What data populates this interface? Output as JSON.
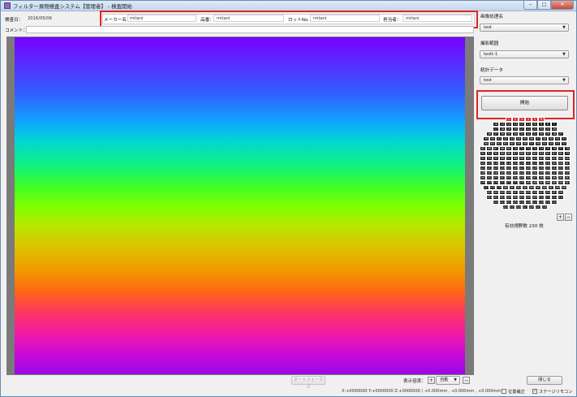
{
  "window": {
    "title": "フィルター異物検査システム【管理者】 - 検査開始",
    "min": "‒",
    "max": "□",
    "close": "✕"
  },
  "header": {
    "date_label": "検査日：",
    "date_value": "2016/05/06",
    "maker_label": "メーカー名：",
    "maker_value": "mitani",
    "product_label": "品番：",
    "product_value": "mitani",
    "lot_label": "ロットNo.：",
    "lot_value": "mitani",
    "person_label": "担当者：",
    "person_value": "mitani",
    "comment_label": "コメント："
  },
  "right": {
    "image_proc_label": "画像処理名",
    "image_proc_value": "test",
    "capture_range_label": "撮影範囲",
    "capture_range_value": "testt-1",
    "stats_label": "統計データ",
    "stats_value": "test",
    "start_button": "開始",
    "plus": "+",
    "minus": "−",
    "valid_fields": "有効視野数 230 枚"
  },
  "grid": {
    "rows": [
      {
        "cells": [
          "1",
          "2",
          "3",
          "4",
          "5",
          "6"
        ],
        "red": true
      },
      {
        "cells": [
          "16",
          "15",
          "14",
          "13",
          "12",
          "11",
          "10",
          "9",
          "8",
          "7"
        ]
      },
      {
        "cells": [
          "17",
          "18",
          "19",
          "20",
          "21",
          "22",
          "23",
          "24",
          "25",
          "26"
        ]
      },
      {
        "cells": [
          "38",
          "37",
          "36",
          "35",
          "34",
          "33",
          "32",
          "31",
          "30",
          "29",
          "28",
          "27"
        ]
      },
      {
        "cells": [
          "39",
          "40",
          "41",
          "42",
          "43",
          "44",
          "45",
          "46",
          "47",
          "48",
          "49",
          "50",
          "51"
        ]
      },
      {
        "cells": [
          "64",
          "63",
          "62",
          "61",
          "60",
          "59",
          "58",
          "57",
          "56",
          "55",
          "54",
          "53",
          "52"
        ]
      },
      {
        "cells": [
          "65",
          "66",
          "67",
          "68",
          "69",
          "70",
          "71",
          "72",
          "73",
          "74",
          "75",
          "76",
          "77",
          "78"
        ]
      },
      {
        "cells": [
          "92",
          "91",
          "90",
          "89",
          "88",
          "87",
          "86",
          "85",
          "84",
          "83",
          "82",
          "81",
          "80",
          "79"
        ]
      },
      {
        "cells": [
          "93",
          "94",
          "95",
          "96",
          "97",
          "98",
          "99",
          "100",
          "101",
          "102",
          "103",
          "104",
          "105",
          "106"
        ]
      },
      {
        "cells": [
          "120",
          "119",
          "118",
          "117",
          "116",
          "115",
          "114",
          "113",
          "112",
          "111",
          "110",
          "109",
          "108",
          "107"
        ]
      },
      {
        "cells": [
          "121",
          "122",
          "123",
          "124",
          "125",
          "126",
          "127",
          "128",
          "129",
          "130",
          "131",
          "132",
          "133",
          "134"
        ]
      },
      {
        "cells": [
          "148",
          "147",
          "146",
          "145",
          "144",
          "143",
          "142",
          "141",
          "140",
          "139",
          "138",
          "137",
          "136",
          "135"
        ]
      },
      {
        "cells": [
          "149",
          "150",
          "151",
          "152",
          "153",
          "154",
          "155",
          "156",
          "157",
          "158",
          "159",
          "160",
          "161",
          "162"
        ]
      },
      {
        "cells": [
          "176",
          "175",
          "174",
          "173",
          "172",
          "171",
          "170",
          "169",
          "168",
          "167",
          "166",
          "165",
          "164",
          "163"
        ]
      },
      {
        "cells": [
          "177",
          "178",
          "179",
          "180",
          "181",
          "182",
          "183",
          "184",
          "185",
          "186",
          "187",
          "188",
          "189"
        ]
      },
      {
        "cells": [
          "201",
          "200",
          "199",
          "198",
          "197",
          "196",
          "195",
          "194",
          "193",
          "192",
          "191",
          "190"
        ]
      },
      {
        "cells": [
          "202",
          "203",
          "204",
          "205",
          "206",
          "207",
          "208",
          "209",
          "210",
          "211",
          "212",
          "213"
        ]
      },
      {
        "cells": [
          "223",
          "222",
          "221",
          "220",
          "219",
          "218",
          "217",
          "216",
          "215",
          "214"
        ]
      },
      {
        "cells": [
          "224",
          "225",
          "226",
          "227",
          "228",
          "229",
          "230"
        ]
      }
    ]
  },
  "bottom": {
    "autofocus": "オートフォーカス",
    "zoom_label": "表示倍率：",
    "zoom_plus": "+",
    "zoom_value": "自動",
    "zoom_minus": "−",
    "close_button": "閉じる",
    "coords": "X:+0000000  Y:+0000000  Z:+0000000 ( +0.000mm , +0.000mm , +0.000mm)",
    "correction_label": "位置補正",
    "stage_label": "ステージリモコン",
    "stage_checked": "✓"
  }
}
